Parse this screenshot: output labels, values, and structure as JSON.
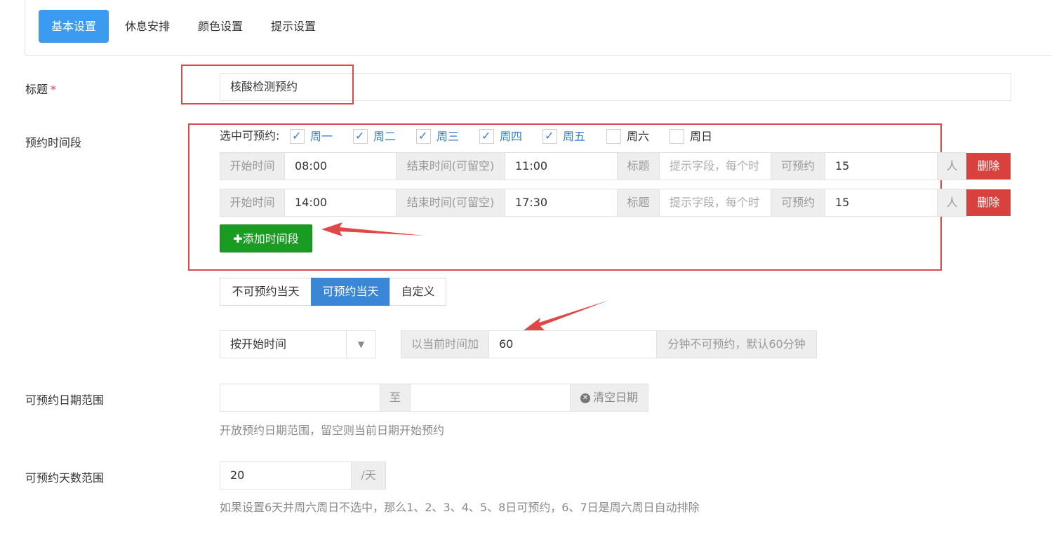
{
  "tabs": [
    {
      "label": "基本设置",
      "active": true
    },
    {
      "label": "休息安排",
      "active": false
    },
    {
      "label": "颜色设置",
      "active": false
    },
    {
      "label": "提示设置",
      "active": false
    }
  ],
  "form": {
    "title_label": "标题",
    "required_mark": "*",
    "title_value": "核酸检测预约",
    "timeslot_label": "预约时间段",
    "weekdays_prompt": "选中可预约:",
    "weekdays": [
      {
        "label": "周一",
        "checked": true
      },
      {
        "label": "周二",
        "checked": true
      },
      {
        "label": "周三",
        "checked": true
      },
      {
        "label": "周四",
        "checked": true
      },
      {
        "label": "周五",
        "checked": true
      },
      {
        "label": "周六",
        "checked": false
      },
      {
        "label": "周日",
        "checked": false
      }
    ],
    "slot_labels": {
      "start": "开始时间",
      "end": "结束时间(可留空)",
      "title": "标题",
      "title_placeholder": "提示字段，每个时",
      "bookable": "可预约",
      "unit": "人",
      "delete": "删除"
    },
    "slots": [
      {
        "start": "08:00",
        "end": "11:00",
        "capacity": "15"
      },
      {
        "start": "14:00",
        "end": "17:30",
        "capacity": "15"
      }
    ],
    "add_slot_label": "添加时间段",
    "sameday_options": [
      {
        "label": "不可预约当天",
        "active": false
      },
      {
        "label": "可预约当天",
        "active": true
      },
      {
        "label": "自定义",
        "active": false
      }
    ],
    "time_basis_value": "按开始时间",
    "offset_prefix": "以当前时间加",
    "offset_value": "60",
    "offset_suffix": "分钟不可预约，默认60分钟",
    "date_range_label": "可预约日期范围",
    "date_range_to": "至",
    "clear_date_label": "清空日期",
    "date_range_hint": "开放预约日期范围，留空则当前日期开始预约",
    "days_range_label": "可预约天数范围",
    "days_value": "20",
    "days_unit": "/天",
    "days_hint": "如果设置6天并周六周日不选中，那么1、2、3、4、5、8日可预约，6、7日是周六周日自动排除"
  },
  "colors": {
    "primary": "#3a9bf0",
    "success": "#1a9b21",
    "danger": "#d9413d",
    "annotation_red": "#e04848"
  }
}
